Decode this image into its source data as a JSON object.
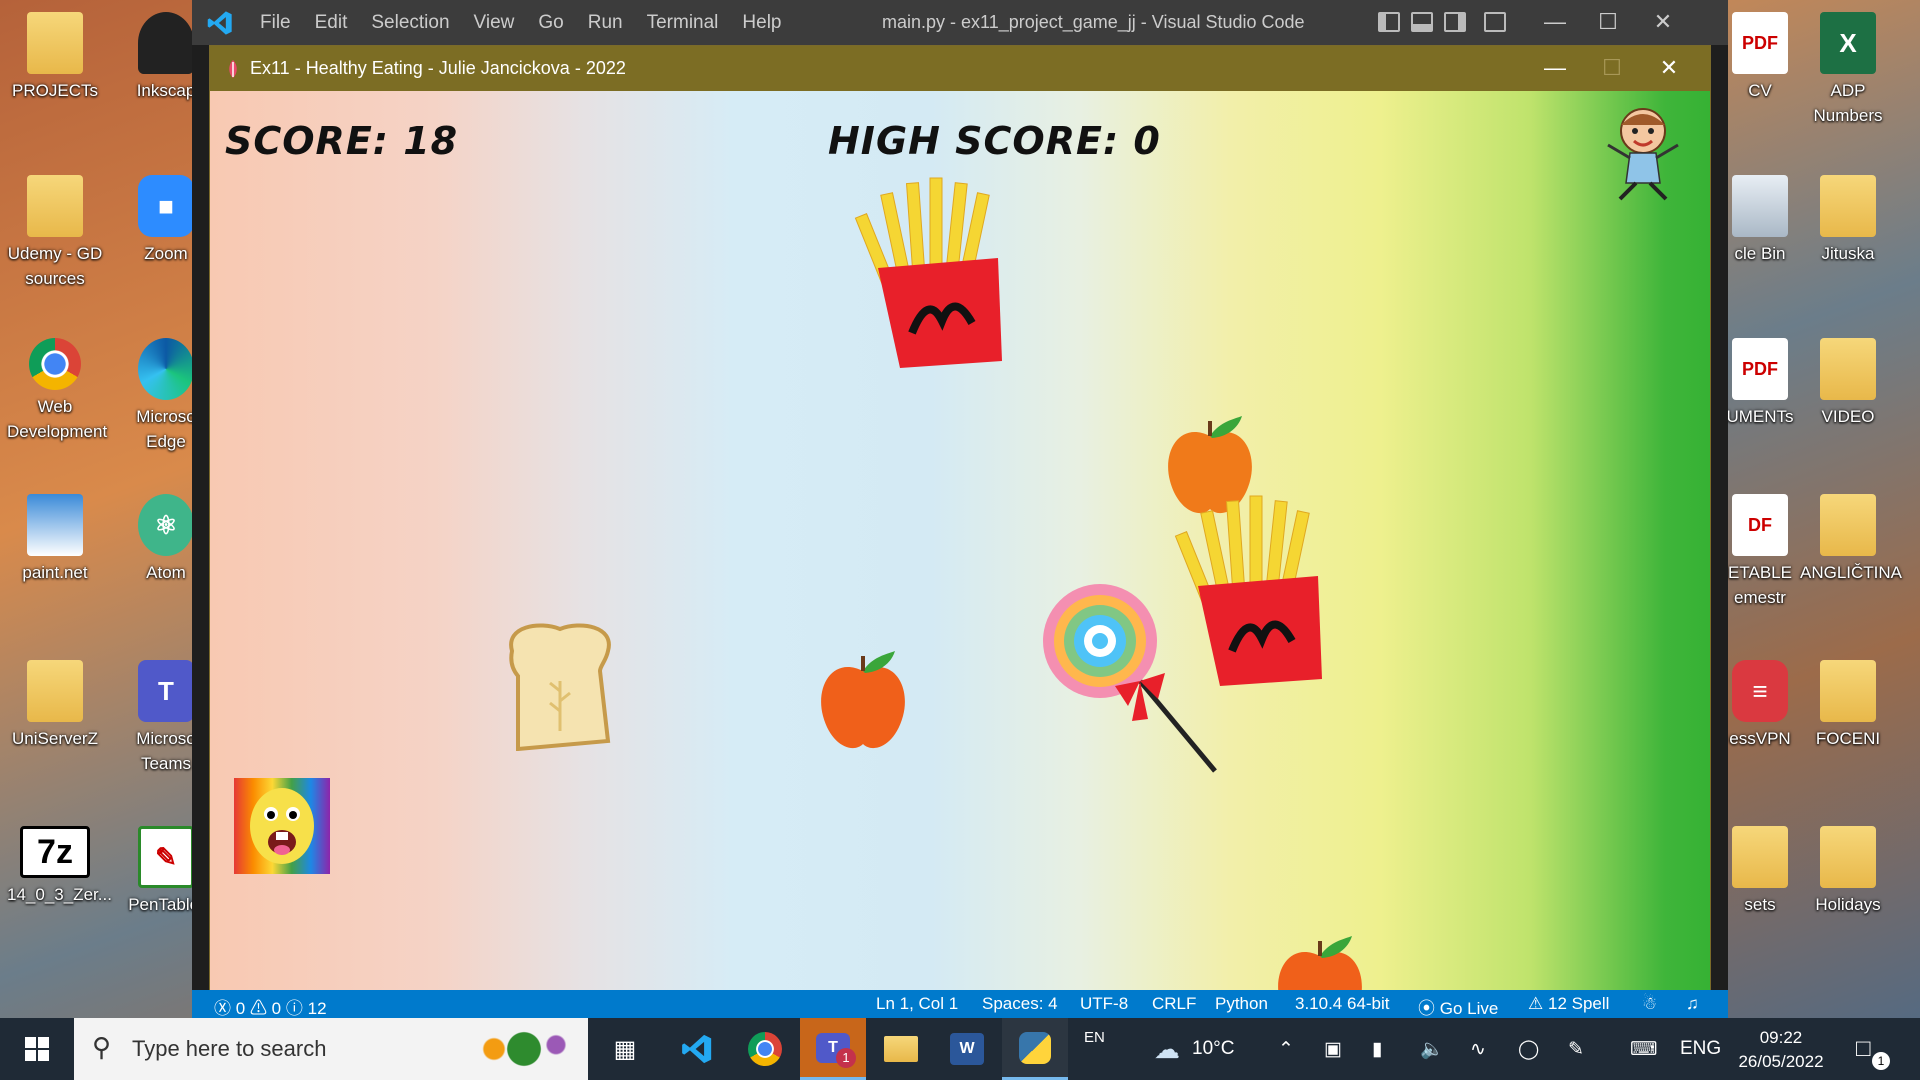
{
  "desktop": {
    "left_icons": [
      {
        "label": "PROJECTs"
      },
      {
        "label": "Udemy - GD sources"
      },
      {
        "label": "Web Development"
      },
      {
        "label": "paint.net"
      },
      {
        "label": "UniServerZ"
      },
      {
        "label": "14_0_3_Zer..."
      }
    ],
    "second_icons": [
      {
        "label": "Inkscap"
      },
      {
        "label": "Zoom"
      },
      {
        "label": "Microso Edge"
      },
      {
        "label": "Atom"
      },
      {
        "label": "Microso Teams"
      },
      {
        "label": "PenTablet"
      }
    ],
    "right_partial_icons": [
      {
        "label": "CV"
      },
      {
        "label": "cle Bin"
      },
      {
        "label": "UMENTs"
      },
      {
        "label": "ETABLE emestr"
      },
      {
        "label": "essVPN"
      },
      {
        "label": "sets"
      }
    ],
    "right_icons": [
      {
        "label": "ADP Numbers"
      },
      {
        "label": "Jituska"
      },
      {
        "label": "VIDEO"
      },
      {
        "label": "ANGLIČTINA"
      },
      {
        "label": "FOCENI"
      },
      {
        "label": "Holidays"
      }
    ]
  },
  "vscode": {
    "menu": [
      "File",
      "Edit",
      "Selection",
      "View",
      "Go",
      "Run",
      "Terminal",
      "Help"
    ],
    "title": "main.py - ex11_project_game_jj - Visual Studio Code",
    "status": {
      "errors": "0",
      "warnings": "0",
      "infos": "12",
      "position": "Ln 1, Col 1",
      "spaces": "Spaces: 4",
      "encoding": "UTF-8",
      "eol": "CRLF",
      "language": "Python",
      "interpreter": "3.10.4 64-bit",
      "golive": "Go Live",
      "spell": "12 Spell"
    }
  },
  "game": {
    "title": "Ex11 - Healthy Eating - Julie Jancickova - 2022",
    "score_label": "SCORE: 18",
    "high_score_label": "HIGH SCORE: 0"
  },
  "taskbar": {
    "search_placeholder": "Type here to search",
    "ime": "EN",
    "weather": "10°C",
    "language": "ENG",
    "time": "09:22",
    "date": "26/05/2022",
    "notification_count": "1",
    "teams_badge": "1"
  }
}
